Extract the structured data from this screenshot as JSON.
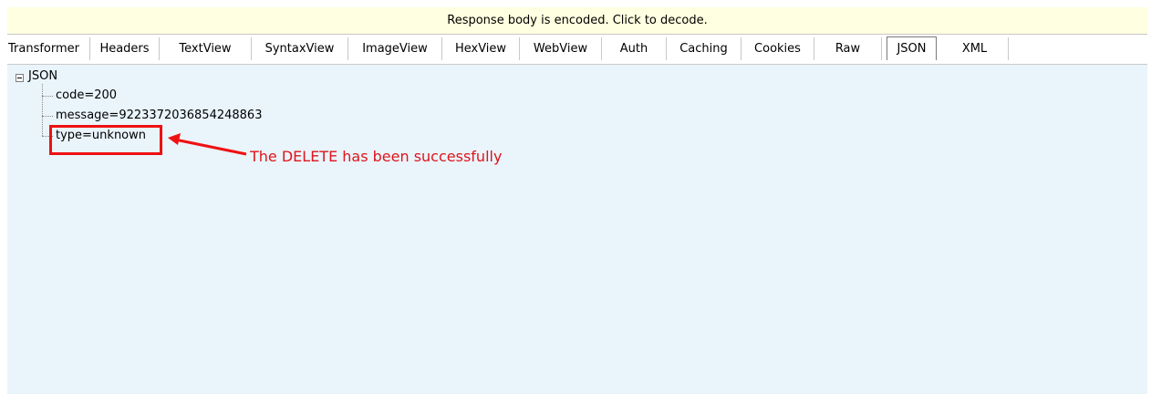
{
  "notice": {
    "text": "Response body is encoded. Click to decode."
  },
  "tabs": [
    {
      "label": "Transformer",
      "active": false
    },
    {
      "label": "Headers",
      "active": false
    },
    {
      "label": "TextView",
      "active": false
    },
    {
      "label": "SyntaxView",
      "active": false
    },
    {
      "label": "ImageView",
      "active": false
    },
    {
      "label": "HexView",
      "active": false
    },
    {
      "label": "WebView",
      "active": false
    },
    {
      "label": "Auth",
      "active": false
    },
    {
      "label": "Caching",
      "active": false
    },
    {
      "label": "Cookies",
      "active": false
    },
    {
      "label": "Raw",
      "active": false
    },
    {
      "label": "JSON",
      "active": true
    },
    {
      "label": "XML",
      "active": false
    }
  ],
  "tree": {
    "root": "JSON",
    "children": [
      "code=200",
      "message=9223372036854248863",
      "type=unknown"
    ]
  },
  "annotation": {
    "text": "The DELETE has been successfully",
    "color": "#e0141b"
  },
  "colors": {
    "notice_bg": "#ffffe1",
    "content_bg": "#eaf4fb",
    "highlight": "#ee1111"
  }
}
